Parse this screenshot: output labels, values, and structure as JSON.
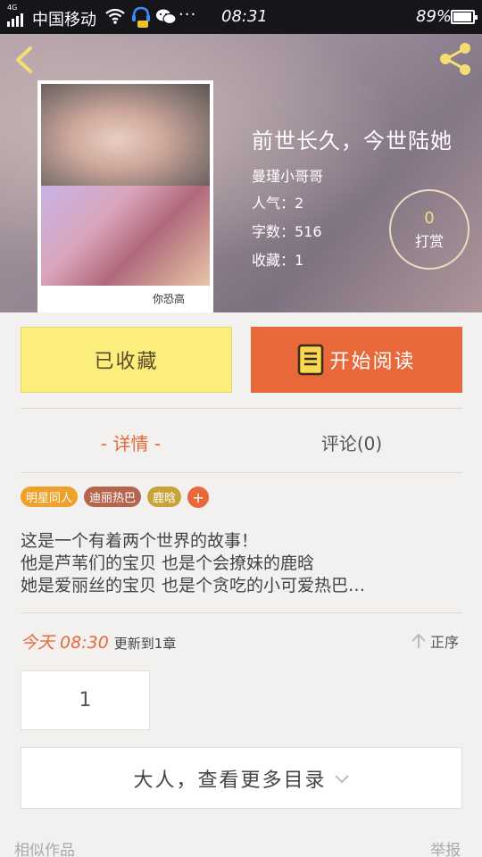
{
  "status_bar": {
    "network_type": "4G",
    "carrier": "中国移动",
    "more": "···",
    "time": "08:31",
    "battery": "89%"
  },
  "book": {
    "title": "前世长久，今世陆她",
    "author": "曼瑾小哥哥",
    "popularity": "人气：2",
    "word_count": "字数：516",
    "favorites": "收藏：1",
    "cover_caption": "你恐高"
  },
  "tip": {
    "count": "0",
    "label": "打赏"
  },
  "actions": {
    "favorited": "已收藏",
    "start_reading": "开始阅读"
  },
  "tabs": {
    "detail": "- 详情 -",
    "comments": "评论(0)"
  },
  "tags": [
    {
      "label": "明星同人",
      "color": "#f0a12a"
    },
    {
      "label": "迪丽热巴",
      "color": "#b5654e"
    },
    {
      "label": "鹿晗",
      "color": "#caa23a"
    }
  ],
  "tag_add": "+",
  "description": [
    "这是一个有着两个世界的故事！",
    "他是芦苇们的宝贝 也是个会撩妹的鹿晗",
    "她是爱丽丝的宝贝 也是个贪吃的小可爱热巴…"
  ],
  "update": {
    "time": "今天 08:30",
    "text": "更新到1章"
  },
  "sort_label": "正序",
  "chapter_number": "1",
  "more_catalog": "大人，查看更多目录",
  "footer": {
    "similar": "相似作品",
    "report": "举报"
  },
  "colors": {
    "accent": "#e8683a",
    "fav_button": "#fbee7c"
  }
}
